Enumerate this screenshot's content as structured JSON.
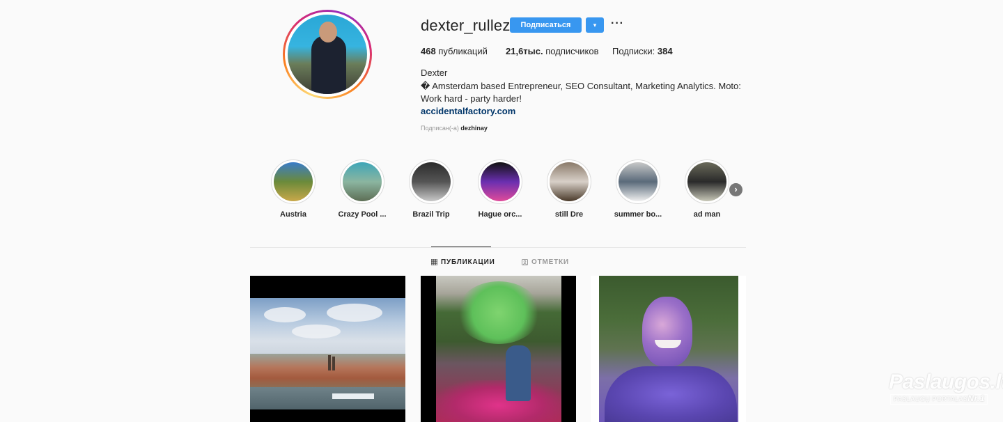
{
  "profile": {
    "username": "dexter_rullez",
    "follow_label": "Подписаться",
    "dropdown_icon": "▾",
    "more_icon": "···",
    "stats": {
      "posts_value": "468",
      "posts_label": "публикаций",
      "followers_value": "21,6тыс.",
      "followers_label": "подписчиков",
      "following_label": "Подписки:",
      "following_value": "384"
    },
    "full_name": "Dexter",
    "bio": "� Amsterdam based Entrepreneur, SEO Consultant, Marketing Analytics. Moto: Work hard - party harder!",
    "website": "accidentalfactory.com",
    "followed_by_label": "Подписан(-а)",
    "followed_by_user": "dezhinay"
  },
  "highlights": [
    {
      "label": "Austria",
      "colors": [
        "#3a7cc9",
        "#6b8a3a",
        "#c9a84a"
      ]
    },
    {
      "label": "Crazy Pool ...",
      "colors": [
        "#3fa6b8",
        "#8bb5a0",
        "#5d6e55"
      ]
    },
    {
      "label": "Brazil Trip",
      "colors": [
        "#2b2b2b",
        "#555555",
        "#c8c8c8"
      ]
    },
    {
      "label": "Hague orc...",
      "colors": [
        "#111111",
        "#6a2fb0",
        "#e04a9a"
      ]
    },
    {
      "label": "still Dre",
      "colors": [
        "#8a7a6a",
        "#d8d0c8",
        "#4a3a2a"
      ]
    },
    {
      "label": "summer bo...",
      "colors": [
        "#c8c8c8",
        "#5a6a7a",
        "#f0f0f0"
      ]
    },
    {
      "label": "ad man",
      "colors": [
        "#6a6a5a",
        "#2a2a2a",
        "#c8c8b8"
      ]
    }
  ],
  "highlights_next_icon": "›",
  "tabs": [
    {
      "label": "ПУБЛИКАЦИИ",
      "icon": "grid-icon",
      "active": true
    },
    {
      "label": "ОТМЕТКИ",
      "icon": "tag-icon",
      "active": false
    }
  ],
  "watermark": {
    "logo": "Paslaugos.lt",
    "tagline": "PASLAUGŲ PORTALAS",
    "rank": "Nr.1"
  },
  "colors": {
    "accent": "#3897f0",
    "link": "#003569",
    "text": "#262626",
    "muted": "#999999"
  }
}
